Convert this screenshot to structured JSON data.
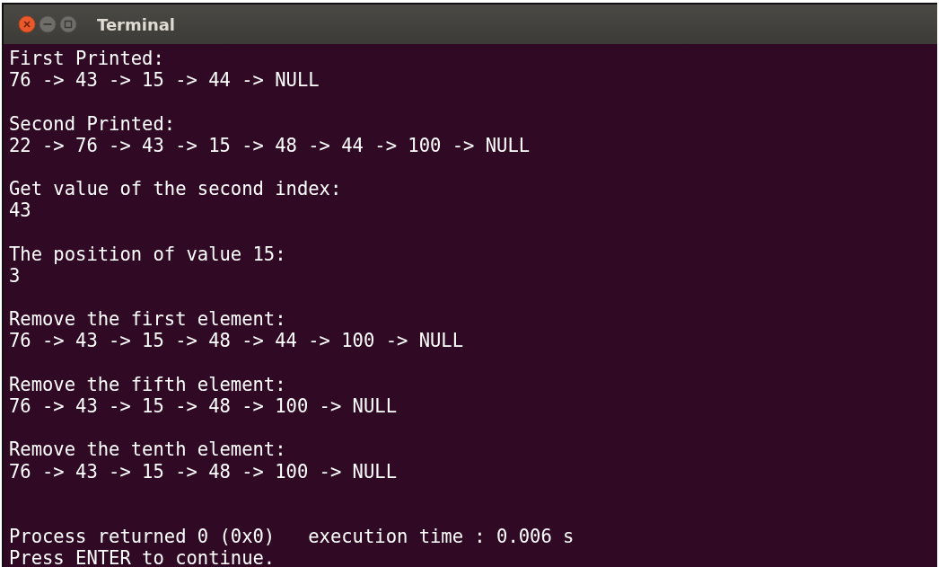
{
  "window": {
    "title": "Terminal"
  },
  "output": [
    {
      "kind": "result",
      "lines": [
        "First Printed:",
        "76 -> 43 -> 15 -> 44 -> NULL"
      ]
    },
    {
      "kind": "result",
      "lines": [
        "Second Printed:",
        "22 -> 76 -> 43 -> 15 -> 48 -> 44 -> 100 -> NULL"
      ]
    },
    {
      "kind": "result",
      "lines": [
        "Get value of the second index:",
        "43"
      ]
    },
    {
      "kind": "result",
      "lines": [
        "The position of value 15:",
        "3"
      ]
    },
    {
      "kind": "result",
      "lines": [
        "Remove the first element:",
        "76 -> 43 -> 15 -> 48 -> 44 -> 100 -> NULL"
      ]
    },
    {
      "kind": "result",
      "lines": [
        "Remove the fifth element:",
        "76 -> 43 -> 15 -> 48 -> 100 -> NULL"
      ]
    },
    {
      "kind": "result",
      "lines": [
        "Remove the tenth element:",
        "76 -> 43 -> 15 -> 48 -> 100 -> NULL"
      ]
    },
    {
      "kind": "status",
      "lines": [
        "Process returned 0 (0x0)   execution time : 0.006 s",
        "Press ENTER to continue."
      ]
    }
  ]
}
